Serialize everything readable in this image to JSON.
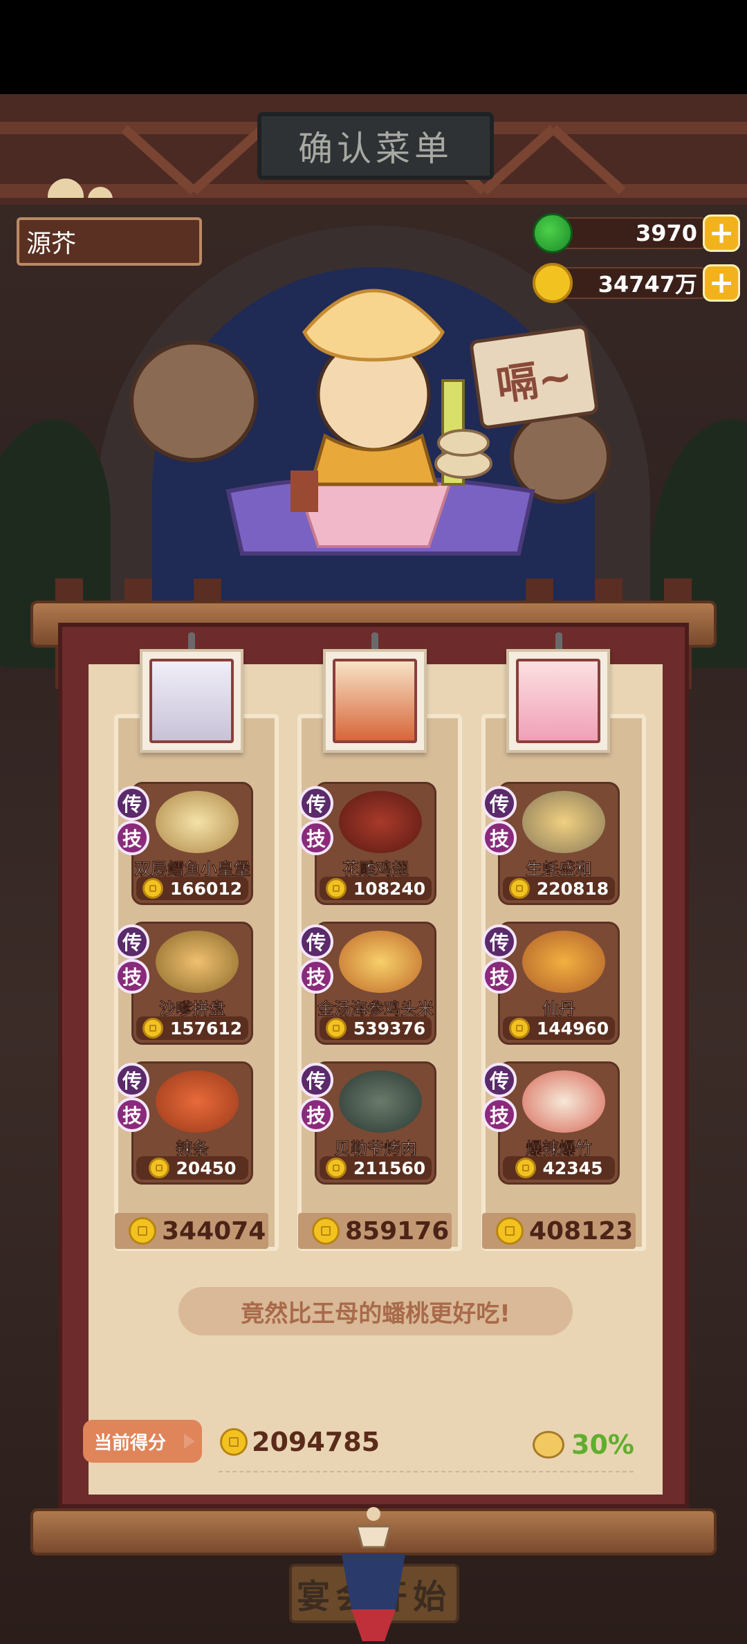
{
  "header": {
    "sign_title": "确认菜单",
    "player_name": "源芥",
    "currencies": [
      {
        "icon": "jade-icon",
        "value": "3970"
      },
      {
        "icon": "coin-icon",
        "value": "34747万"
      }
    ],
    "plus_label": "+"
  },
  "speech_bubble": "嗝~",
  "columns": [
    {
      "dishes": [
        {
          "name": "双层鳕鱼小皇堡",
          "price": "166012",
          "badges": [
            "传",
            "技"
          ]
        },
        {
          "name": "沙嗲拼盘",
          "price": "157612",
          "badges": [
            "传",
            "技"
          ]
        },
        {
          "name": "辣条",
          "price": "20450",
          "badges": [
            "传",
            "技"
          ]
        }
      ],
      "total": "344074"
    },
    {
      "dishes": [
        {
          "name": "花雕鸡翅",
          "price": "108240",
          "badges": [
            "传",
            "技"
          ]
        },
        {
          "name": "金汤海参鸡头米",
          "price": "539376",
          "badges": [
            "传",
            "技"
          ]
        },
        {
          "name": "贝勒爷烤肉",
          "price": "211560",
          "badges": [
            "传",
            "技"
          ]
        }
      ],
      "total": "859176"
    },
    {
      "dishes": [
        {
          "name": "生蚝盛和",
          "price": "220818",
          "badges": [
            "传",
            "技"
          ]
        },
        {
          "name": "仙丹",
          "price": "144960",
          "badges": [
            "传",
            "技"
          ]
        },
        {
          "name": "爆辣爆竹",
          "price": "42345",
          "badges": [
            "传",
            "技"
          ]
        }
      ],
      "total": "408123"
    }
  ],
  "comment": "竟然比王母的蟠桃更好吃!",
  "score": {
    "label": "当前得分",
    "value": "2094785",
    "bonus": "30%"
  },
  "start_button": "宴会开始",
  "colors": {
    "scroll_paper": "#e9d5b4",
    "scroll_frame": "#6e2b2b",
    "dish_card": "#7a4a34",
    "gold": "#f2b21e",
    "bonus_green": "#5fae2e"
  }
}
